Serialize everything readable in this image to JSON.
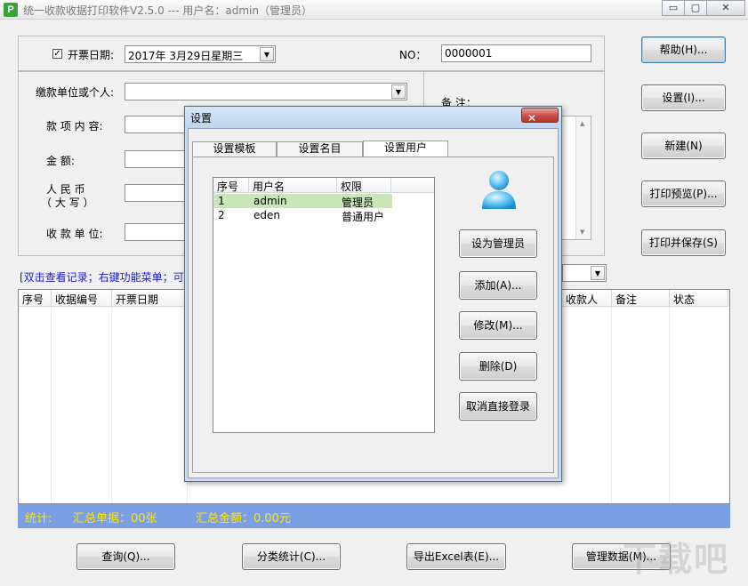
{
  "window": {
    "title": "统一收款收据打印软件V2.5.0 --- 用户名：admin（管理员）",
    "app_icon_letter": "P",
    "minimize": "▭",
    "maximize": "▢",
    "close": "✕"
  },
  "form": {
    "invoice_date_checked": true,
    "invoice_date_label": "开票日期:",
    "invoice_date_value": "2017年  3月29日星期三",
    "no_label": "NO：",
    "no_value": "0000001",
    "payer_label": "缴款单位或个人:",
    "payer_value": "",
    "item_label": "款 项 内 容:",
    "amount_label": "金      额:",
    "rmb_label_line1": "人  民  币",
    "rmb_label_line2": "（ 大 写 ）",
    "payee_label": "收 款 单 位:",
    "remarks_label": "备 注："
  },
  "right_buttons": [
    "帮助(H)...",
    "设置(I)...",
    "新建(N)",
    "打印预览(P)...",
    "打印并保存(S)"
  ],
  "records": {
    "hint": "[双击查看记录；右键功能菜单；可",
    "columns_left": [
      "序号",
      "收据编号",
      "开票日期"
    ],
    "columns_right": [
      "收款人",
      "备注",
      "状态"
    ]
  },
  "summary": {
    "total_label": "统计:",
    "count_text": "汇总单据：00张",
    "amount_text": "汇总金额：0.00元"
  },
  "bottom_buttons": [
    "查询(Q)...",
    "分类统计(C)...",
    "导出Excel表(E)...",
    "管理数据(M)..."
  ],
  "dialog": {
    "title": "设置",
    "close": "✕",
    "tabs": [
      "设置模板",
      "设置名目",
      "设置用户"
    ],
    "active_tab": 2,
    "user_columns": [
      "序号",
      "用户名",
      "权限"
    ],
    "users": [
      {
        "index": "1",
        "name": "admin",
        "role": "管理员"
      },
      {
        "index": "2",
        "name": "eden",
        "role": "普通用户"
      }
    ],
    "buttons": [
      "设为管理员",
      "添加(A)...",
      "修改(M)...",
      "删除(D)",
      "取消直接登录"
    ]
  },
  "watermark": "下载吧",
  "colors": {
    "summary_bg": "#7b9fe6",
    "summary_text": "#ffe600",
    "selected_row": "#c8e6b8",
    "dialog_frame": "#c9dbf1"
  },
  "icons": {
    "user_avatar": "user-avatar-icon",
    "dropdown": "chevron-down-icon",
    "checkbox": "checkbox-checked-icon"
  }
}
